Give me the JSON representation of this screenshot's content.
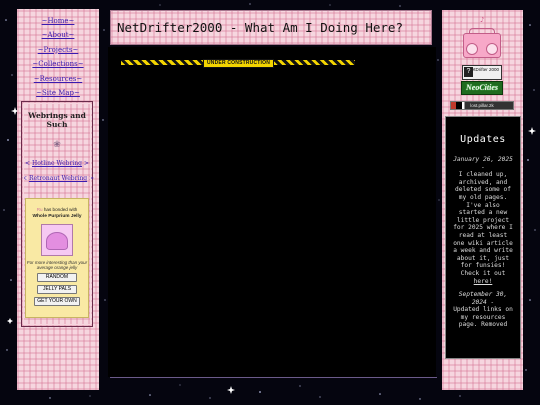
{
  "nav": {
    "items": [
      {
        "label": "~Home~"
      },
      {
        "label": "~About~"
      },
      {
        "label": "~Projects~"
      },
      {
        "label": "~Collections~"
      },
      {
        "label": "~Resources~"
      },
      {
        "label": "~Site Map~"
      }
    ]
  },
  "webrings": {
    "title": "Webrings and Such",
    "rings": [
      {
        "prev": "<",
        "label": "Hotline Webring",
        "next": ">"
      },
      {
        "prev": "<",
        "label": "Retronaut Webring",
        "next": ">"
      }
    ]
  },
  "jelly": {
    "by": "Ru",
    "bonded_text": "has bonded with",
    "name": "Whole Purprium Jelly",
    "more_text": "For more interesting than your average orange jelly",
    "buttons": [
      "RANDOM",
      "JELLY PALS",
      "GET YOUR OWN"
    ]
  },
  "header": {
    "title": "NetDrifter2000 - What Am I Doing Here?"
  },
  "main": {
    "construction_label": "UNDER CONSTRUCTION"
  },
  "badges": {
    "netdrifter": {
      "q": "?",
      "text": "NetDrifter 2000"
    },
    "neocities": "NeoCities",
    "third": "lost.pillar.2k"
  },
  "updates": {
    "title": "Updates",
    "entries": [
      {
        "date": "January 26, 2025 -",
        "text": "I cleaned up, archived, and deleted some of my old pages. I've also started a new little project for 2025 where I read at least one wiki article a week and write about it, just for funsies! Check it out",
        "link": "here!"
      },
      {
        "date": "September 30, 2024 -",
        "text": "Updated links on my resources page. Removed",
        "link": ""
      }
    ]
  },
  "colors": {
    "background": "#05050f",
    "sidebar_pink": "#f6d6df",
    "link": "#3a1bb0",
    "construction_yellow": "#f3d400"
  }
}
